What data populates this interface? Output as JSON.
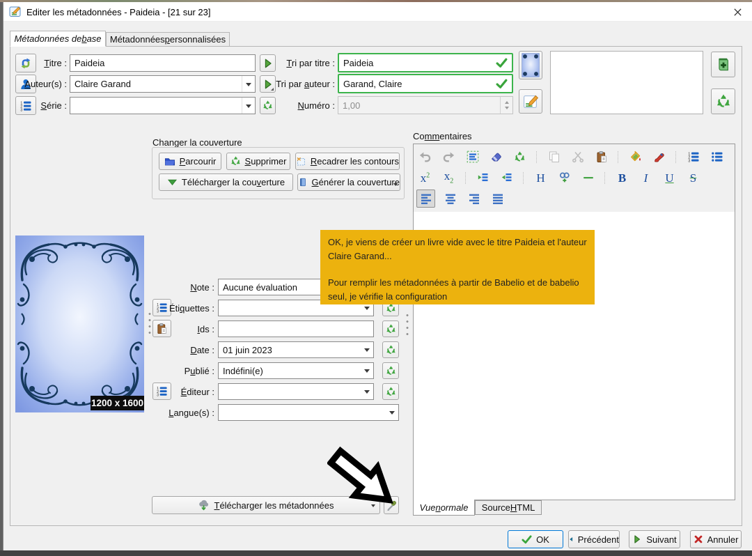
{
  "window": {
    "title": "Editer les métadonnées - Paideia -  [21 sur 23]"
  },
  "tabs": {
    "basic": {
      "pre": "Métadonnées de ",
      "key": "b",
      "post": "ase"
    },
    "custom": {
      "pre": "Métadonnées ",
      "key": "p",
      "post": "ersonnalisées"
    }
  },
  "top_form": {
    "titre": {
      "label": {
        "pre": "",
        "key": "T",
        "post": "itre :"
      },
      "value": "Paideia"
    },
    "auteurs": {
      "label": {
        "pre": "",
        "key": "A",
        "post": "uteur(s) :"
      },
      "value": "Claire Garand"
    },
    "serie": {
      "label": {
        "pre": "",
        "key": "S",
        "post": "érie :"
      },
      "value": ""
    },
    "tri_titre": {
      "label": {
        "pre": "",
        "key": "T",
        "post": "ri par titre :"
      },
      "value": "Paideia"
    },
    "tri_auteur": {
      "label": {
        "pre": "Tri par ",
        "key": "a",
        "post": "uteur :"
      },
      "value": "Garand, Claire"
    },
    "numero": {
      "label": {
        "pre": "",
        "key": "N",
        "post": "uméro :"
      },
      "value": "1,00"
    }
  },
  "cover_tools": {
    "title": "Changer la couverture",
    "parcourir": {
      "pre": "",
      "key": "P",
      "post": "arcourir"
    },
    "supprimer": {
      "pre": "",
      "key": "S",
      "post": "upprimer"
    },
    "recadrer": {
      "pre": "",
      "key": "R",
      "post": "ecadrer les contours"
    },
    "telecharger": {
      "pre": "Télécharger la cou",
      "key": "v",
      "post": "erture"
    },
    "generer": {
      "pre": "",
      "key": "G",
      "post": "énérer la couverture"
    }
  },
  "cover": {
    "size_badge": "1200 x 1600"
  },
  "details_form": {
    "note": {
      "label": {
        "pre": "",
        "key": "N",
        "post": "ote :"
      },
      "value": "Aucune évaluation"
    },
    "etiquettes": {
      "label": {
        "pre": "Éti",
        "key": "q",
        "post": "uettes :"
      },
      "value": ""
    },
    "ids": {
      "label": {
        "pre": "",
        "key": "I",
        "post": "ds :"
      },
      "value": ""
    },
    "date": {
      "label": {
        "pre": "",
        "key": "D",
        "post": "ate :"
      },
      "value": "01 juin 2023"
    },
    "publie": {
      "label": {
        "pre": "P",
        "key": "u",
        "post": "blié :"
      },
      "value": "Indéfini(e)"
    },
    "editeur": {
      "label": {
        "pre": "",
        "key": "É",
        "post": "diteur :"
      },
      "value": ""
    },
    "langues": {
      "label": {
        "pre": "",
        "key": "L",
        "post": "angue(s) :"
      },
      "value": ""
    }
  },
  "download": {
    "button": {
      "pre": "",
      "key": "T",
      "post": "élécharger les métadonnées"
    }
  },
  "comments": {
    "title": {
      "pre": "Co",
      "key": "mm",
      "post": "entaires"
    },
    "view_normal": {
      "pre": "Vue ",
      "key": "n",
      "post": "ormale"
    },
    "view_source": {
      "pre": "Source ",
      "key": "H",
      "post": "TML"
    },
    "glyphs": {
      "sup_base": "x",
      "sup_script": "2",
      "sub_base": "x",
      "sub_script": "2",
      "heading": "H",
      "bold": "B",
      "italic": "I",
      "underline": "U",
      "strike": "S"
    }
  },
  "overlay": {
    "tooltip_line1": "OK, je viens de créer un livre vide avec le titre Paideia et l'auteur Claire Garand...",
    "tooltip_line2": "Pour remplir les métadonnées à partir de Babelio et de babelio seul, je vérifie la configuration"
  },
  "footer": {
    "ok": "OK",
    "precedent": "Précédent",
    "suivant": "Suivant",
    "annuler": "Annuler"
  },
  "colors": {
    "valid_green": "#3cb44c",
    "recycle_green": "#3fa53f",
    "accent_blue": "#0078d7",
    "tooltip_bg": "#ecb20e"
  }
}
